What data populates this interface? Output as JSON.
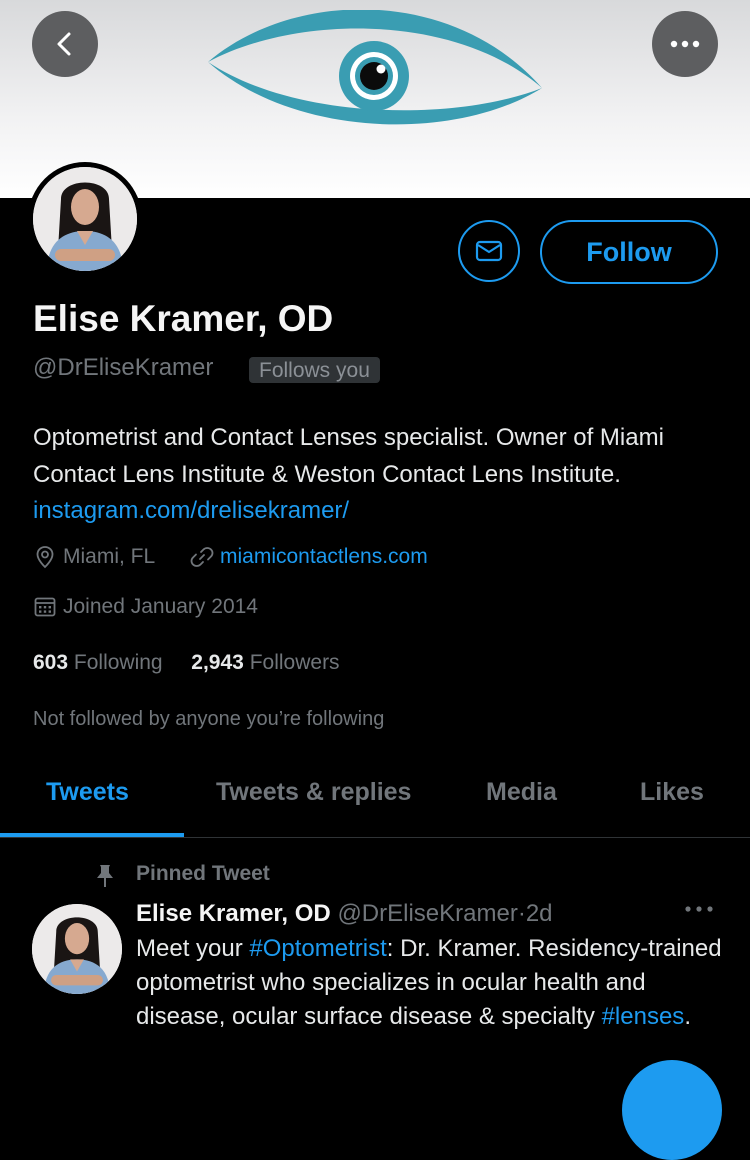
{
  "profile": {
    "name": "Elise Kramer, OD",
    "handle": "@DrEliseKramer",
    "follows_you": "Follows you",
    "bio_text": "Optometrist and Contact Lenses specialist. Owner of Miami Contact Lens Institute & Weston Contact Lens Institute.",
    "bio_link": "instagram.com/drelisekramer/",
    "location": "Miami, FL",
    "website": "miamicontactlens.com",
    "joined": "Joined January 2014",
    "following_count": "603",
    "following_label": "Following",
    "followers_count": "2,943",
    "followers_label": "Followers",
    "not_followed": "Not followed by anyone you’re following"
  },
  "actions": {
    "follow_label": "Follow"
  },
  "icons": {
    "back": "back-arrow-icon",
    "more": "more-icon",
    "message": "envelope-icon",
    "location": "location-pin-icon",
    "link": "link-icon",
    "calendar": "calendar-icon",
    "pin": "pin-icon",
    "tweet_more": "tweet-more-icon",
    "banner_logo": "eye-logo"
  },
  "colors": {
    "accent": "#1d9bf0",
    "background": "#000000",
    "banner_eye": "#3a9db2"
  },
  "tabs": [
    {
      "label": "Tweets",
      "active": true
    },
    {
      "label": "Tweets & replies",
      "active": false
    },
    {
      "label": "Media",
      "active": false
    },
    {
      "label": "Likes",
      "active": false
    }
  ],
  "pinned_tweet": {
    "pinned_label": "Pinned Tweet",
    "author_name": "Elise Kramer, OD",
    "author_handle": "@DrEliseKramer",
    "separator": "·",
    "time": "2d",
    "text_1": "Meet your ",
    "hashtag_1": "#Optometrist",
    "text_2": ": Dr. Kramer. Residency-trained optometrist who specializes in ocular health and disease, ocular surface disease & specialty ",
    "hashtag_2": "#lenses",
    "text_3": "."
  }
}
